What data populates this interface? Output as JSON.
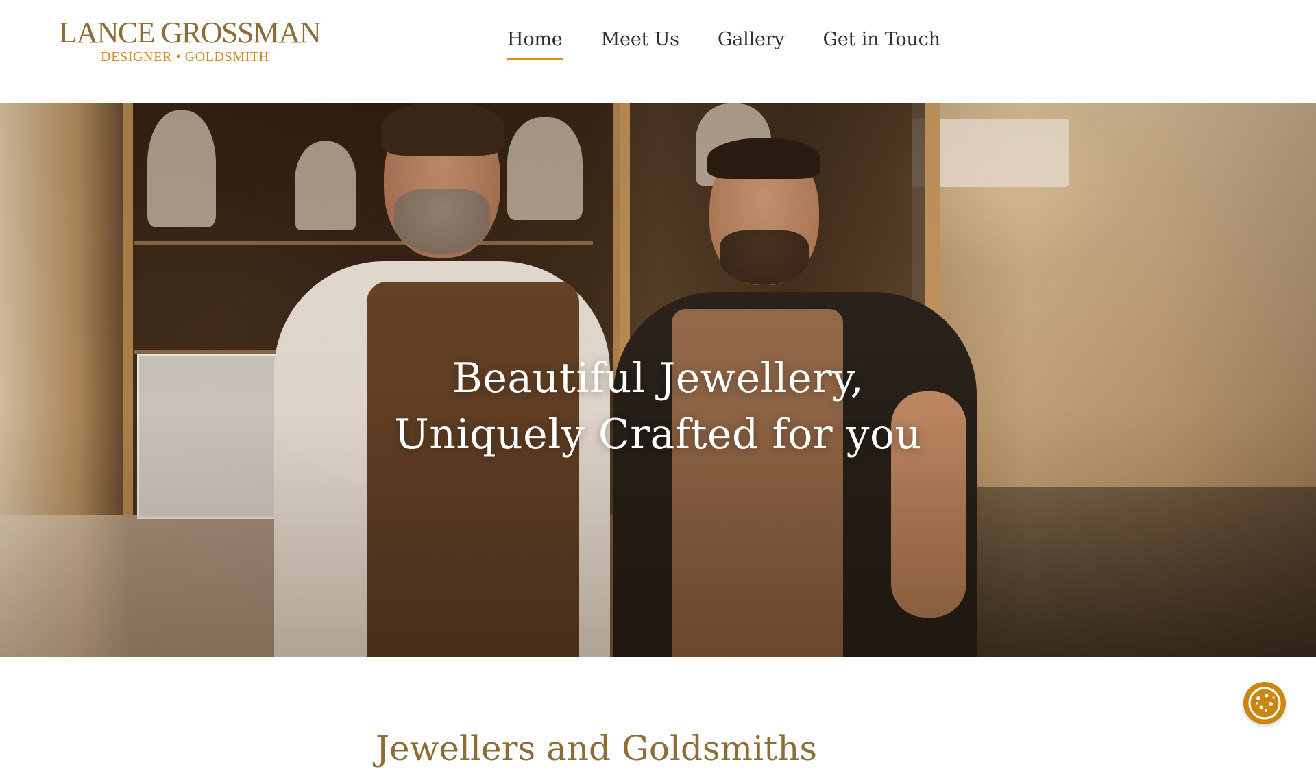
{
  "header": {
    "logo": {
      "name": "LANCE GROSSMAN",
      "tagline": "DESIGNER • GOLDSMITH"
    },
    "nav": [
      {
        "label": "Home",
        "active": true
      },
      {
        "label": "Meet Us",
        "active": false
      },
      {
        "label": "Gallery",
        "active": false
      },
      {
        "label": "Get in Touch",
        "active": false
      }
    ]
  },
  "hero": {
    "title_line1": "Beautiful Jewellery,",
    "title_line2": "Uniquely Crafted for you"
  },
  "main": {
    "section_heading": "Jewellers and Goldsmiths"
  },
  "cookie": {
    "icon": "cookie-icon"
  },
  "colors": {
    "brand": "#8d6c38",
    "accent": "#d88a1c",
    "cookie": "#c98711"
  }
}
